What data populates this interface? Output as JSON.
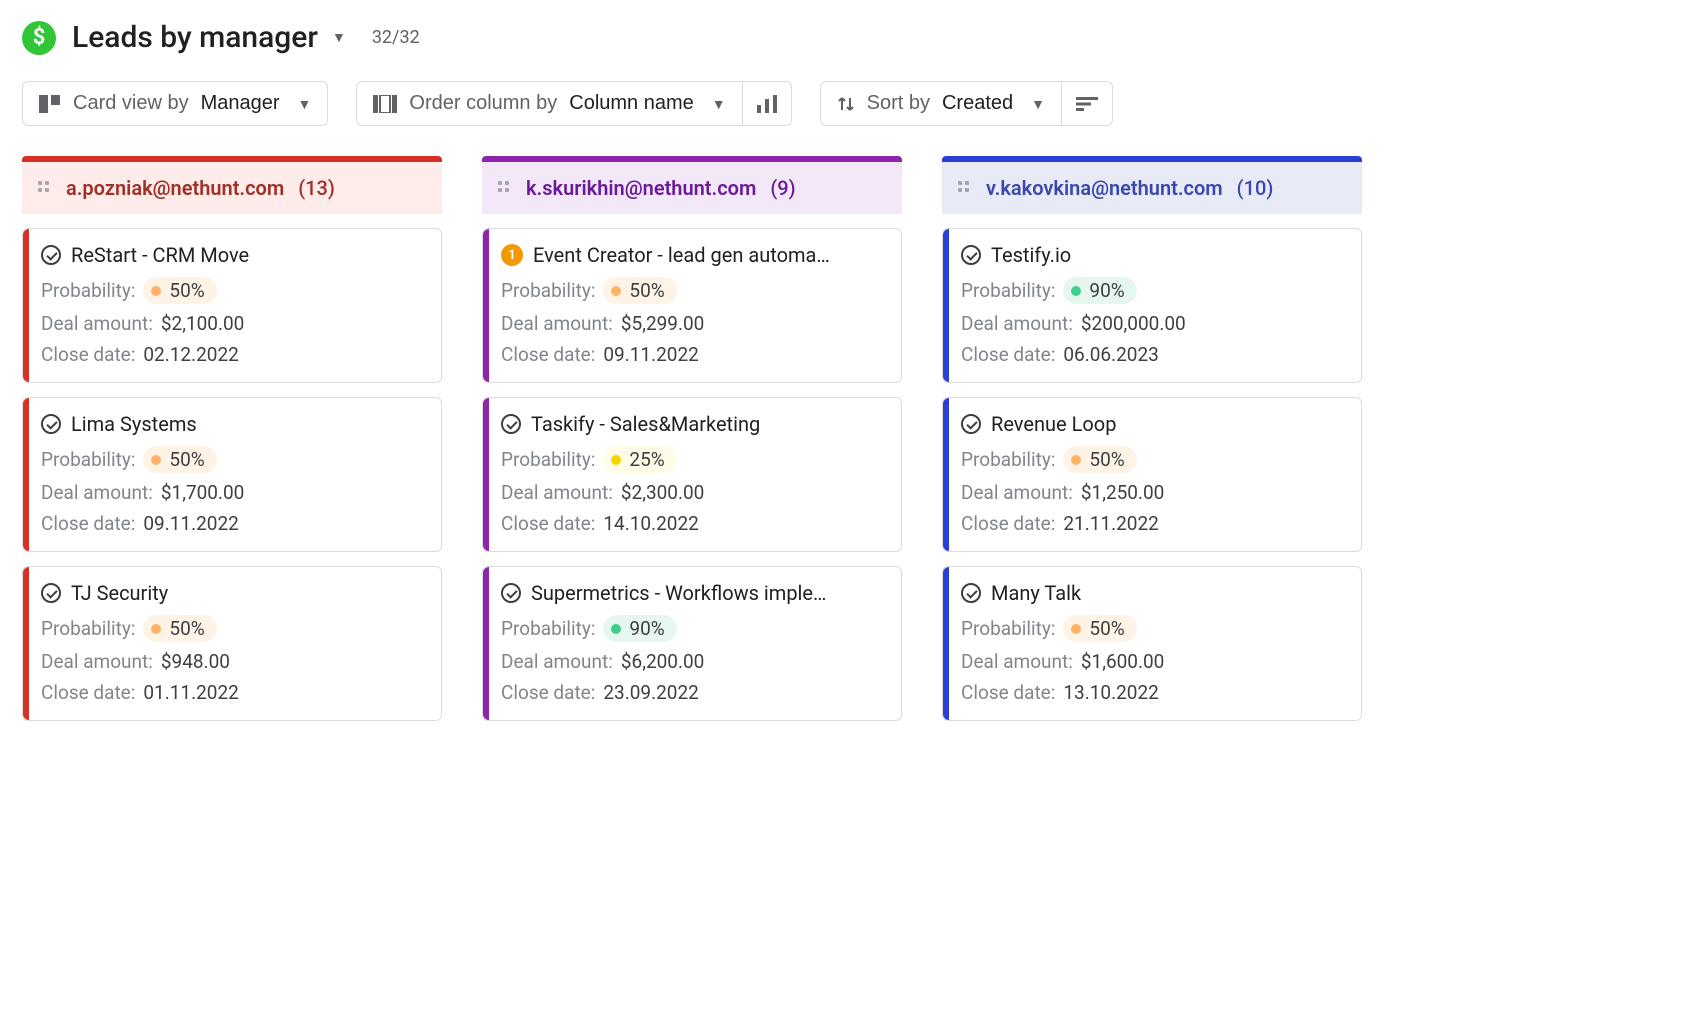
{
  "header": {
    "title": "Leads by manager",
    "count": "32/32"
  },
  "toolbar": {
    "card_view_label": "Card view by",
    "card_view_value": "Manager",
    "order_label": "Order column by",
    "order_value": "Column name",
    "sort_label": "Sort by",
    "sort_value": "Created"
  },
  "labels": {
    "probability": "Probability:",
    "deal_amount": "Deal amount:",
    "close_date": "Close date:"
  },
  "columns": [
    {
      "theme": "red",
      "manager": "a.pozniak@nethunt.com",
      "count": "(13)",
      "cards": [
        {
          "badge": "check",
          "title": "ReStart - CRM Move",
          "probability": "50%",
          "prob_color": "orange",
          "deal_amount": "$2,100.00",
          "close_date": "02.12.2022"
        },
        {
          "badge": "check",
          "title": "Lima Systems",
          "probability": "50%",
          "prob_color": "orange",
          "deal_amount": "$1,700.00",
          "close_date": "09.11.2022"
        },
        {
          "badge": "check",
          "title": "TJ Security",
          "probability": "50%",
          "prob_color": "orange",
          "deal_amount": "$948.00",
          "close_date": "01.11.2022"
        }
      ]
    },
    {
      "theme": "purple",
      "manager": "k.skurikhin@nethunt.com",
      "count": "(9)",
      "cards": [
        {
          "badge": "num",
          "badge_text": "1",
          "title": "Event Creator - lead gen automa…",
          "probability": "50%",
          "prob_color": "orange",
          "deal_amount": "$5,299.00",
          "close_date": "09.11.2022"
        },
        {
          "badge": "check",
          "title": "Taskify - Sales&Marketing",
          "probability": "25%",
          "prob_color": "yellow",
          "deal_amount": "$2,300.00",
          "close_date": "14.10.2022"
        },
        {
          "badge": "check",
          "title": "Supermetrics - Workflows imple…",
          "probability": "90%",
          "prob_color": "green",
          "deal_amount": "$6,200.00",
          "close_date": "23.09.2022"
        }
      ]
    },
    {
      "theme": "blue",
      "manager": "v.kakovkina@nethunt.com",
      "count": "(10)",
      "cards": [
        {
          "badge": "check",
          "title": "Testify.io",
          "probability": "90%",
          "prob_color": "green",
          "deal_amount": "$200,000.00",
          "close_date": "06.06.2023"
        },
        {
          "badge": "check",
          "title": "Revenue Loop",
          "probability": "50%",
          "prob_color": "orange",
          "deal_amount": "$1,250.00",
          "close_date": "21.11.2022"
        },
        {
          "badge": "check",
          "title": "Many Talk",
          "probability": "50%",
          "prob_color": "orange",
          "deal_amount": "$1,600.00",
          "close_date": "13.10.2022"
        }
      ]
    }
  ]
}
